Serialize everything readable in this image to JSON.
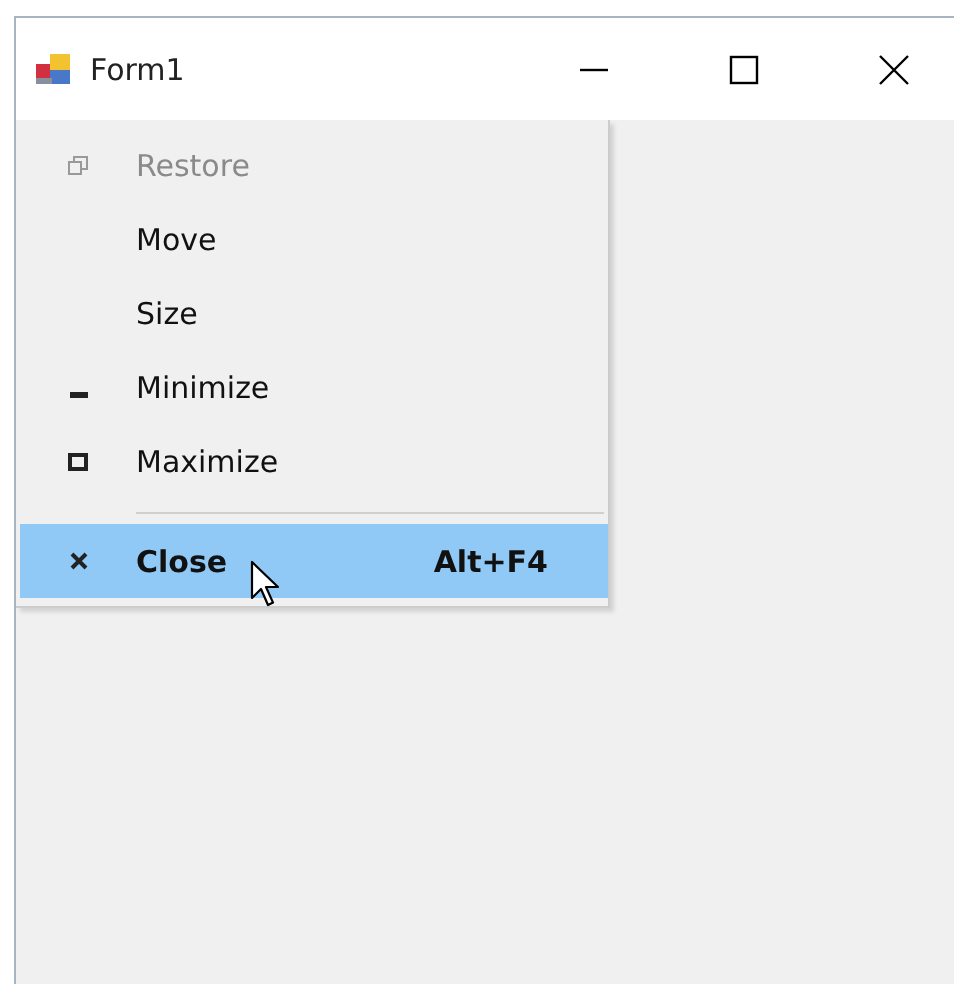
{
  "window": {
    "title": "Form1"
  },
  "system_menu": {
    "items": [
      {
        "kind": "restore",
        "label": "Restore",
        "disabled": true,
        "selected": false
      },
      {
        "kind": "none",
        "label": "Move",
        "disabled": false,
        "selected": false
      },
      {
        "kind": "none",
        "label": "Size",
        "disabled": false,
        "selected": false
      },
      {
        "kind": "minimize",
        "label": "Minimize",
        "disabled": false,
        "selected": false
      },
      {
        "kind": "maximize",
        "label": "Maximize",
        "disabled": false,
        "selected": false
      },
      {
        "kind": "separator"
      },
      {
        "kind": "close",
        "label": "Close",
        "shortcut": "Alt+F4",
        "disabled": false,
        "selected": true
      }
    ]
  }
}
